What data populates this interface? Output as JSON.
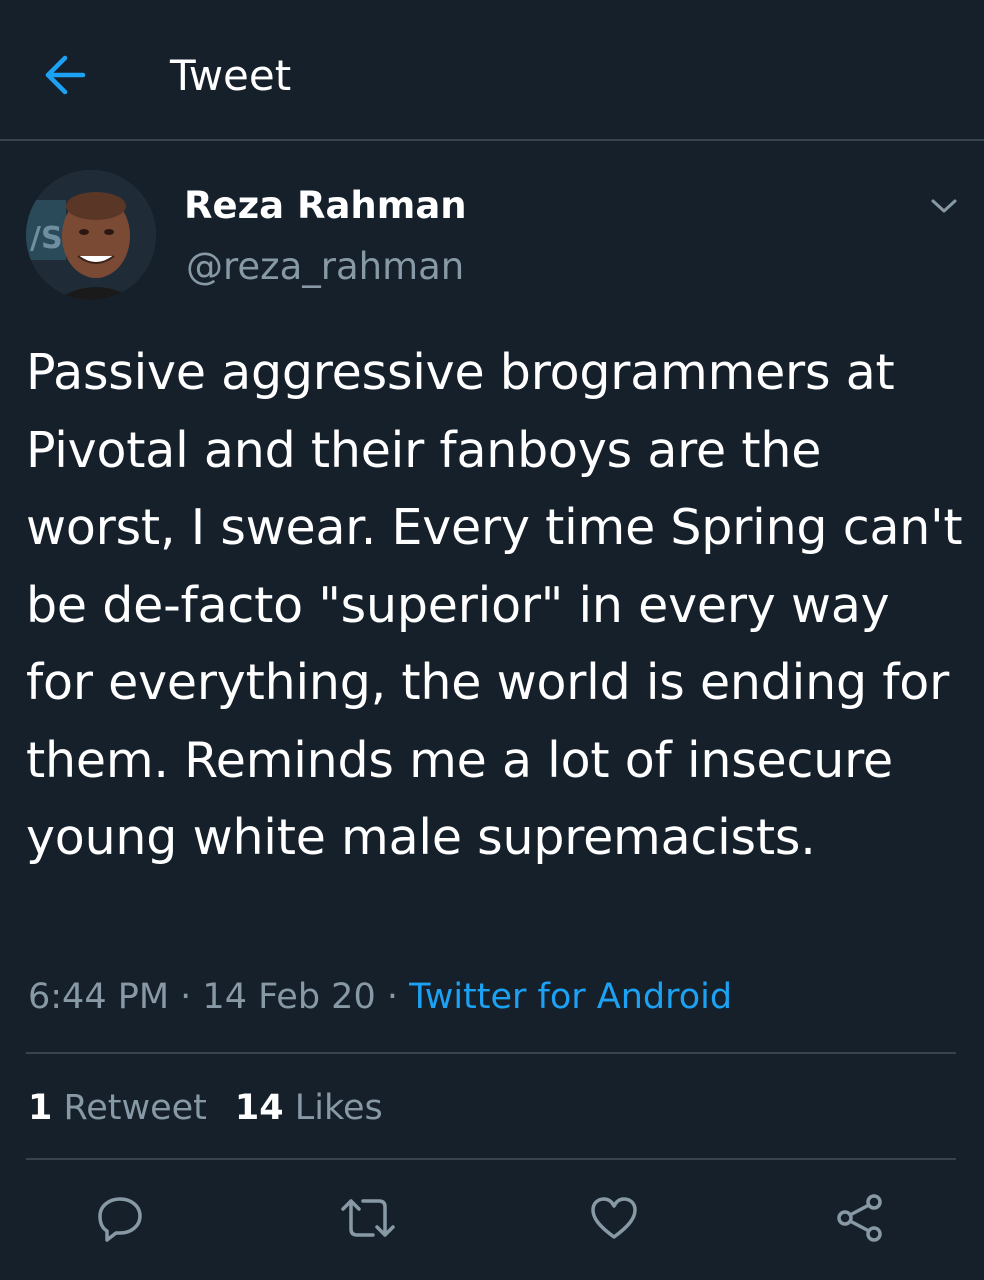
{
  "header": {
    "title": "Tweet"
  },
  "author": {
    "name": "Reza Rahman",
    "handle": "@reza_rahman"
  },
  "tweet": {
    "text": "Passive aggressive brogrammers at Pivotal and their fanboys are the worst, I swear. Every time Spring can't be de-facto \"superior\" in every way for everything, the world is ending for them. Reminds me a lot of insecure young white male supremacists.",
    "time": "6:44 PM",
    "date": "14 Feb 20",
    "source": "Twitter for Android",
    "separator": " · "
  },
  "stats": {
    "retweets_count": "1",
    "retweets_label": " Retweet",
    "likes_count": "14",
    "likes_label": " Likes"
  },
  "icons": {
    "back": "arrow-left-icon",
    "menu": "chevron-down-icon",
    "reply": "reply-icon",
    "retweet": "retweet-icon",
    "like": "heart-icon",
    "share": "share-icon"
  },
  "colors": {
    "background": "#15202b",
    "accent": "#1da1f2",
    "secondary_text": "#8899a6",
    "divider": "#38444d"
  }
}
